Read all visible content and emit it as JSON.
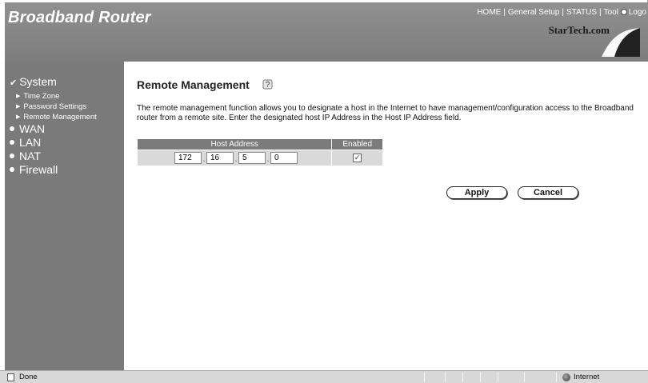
{
  "header": {
    "brand": "Broadband Router",
    "nav": [
      "HOME",
      "General Setup",
      "STATUS",
      "Tool"
    ],
    "logout": "Logo",
    "logo_text": "StarTech.com"
  },
  "sidebar": {
    "system": "System",
    "sub_items": [
      "Time Zone",
      "Password Settings",
      "Remote Management"
    ],
    "items": [
      "WAN",
      "LAN",
      "NAT",
      "Firewall"
    ]
  },
  "main": {
    "title": "Remote Management",
    "description": "The remote management function allows you to designate a host in the Internet to have management/configuration access to the Broadband router from a remote site. Enter the designated host IP Address in the Host IP Address field.",
    "table": {
      "col_host": "Host Address",
      "col_enabled": "Enabled",
      "ip": [
        "172",
        "16",
        "5",
        "0"
      ],
      "enabled_mark": "✓"
    },
    "apply_label": "Apply",
    "cancel_label": "Cancel"
  },
  "statusbar": {
    "status": "Done",
    "zone": "Internet"
  },
  "colors": {
    "header_bg": "#8a8a8a",
    "sidebar_bg": "#7a7a7a",
    "table_header_bg": "#7b7b7b",
    "table_row_bg": "#d9d9d9"
  }
}
